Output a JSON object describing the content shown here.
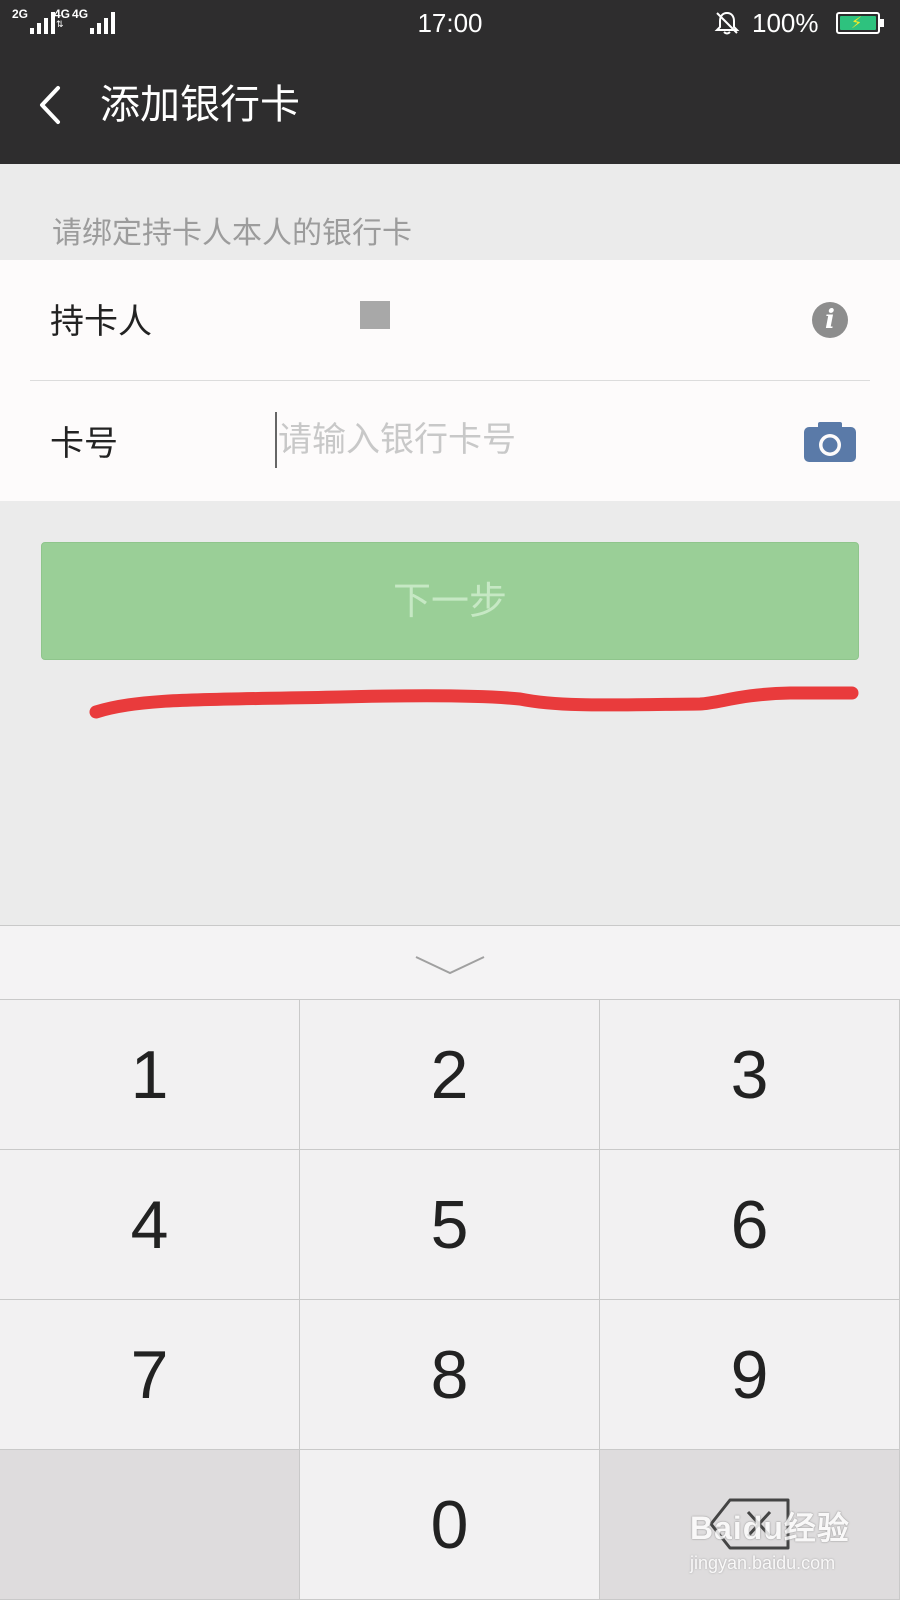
{
  "status_bar": {
    "sim1_label": "2G",
    "sim2_label": "4G",
    "sim2_label_b": "4G",
    "time": "17:00",
    "battery_percent": "100%",
    "battery_level": 1.0,
    "icons": [
      "signal-icon",
      "signal-icon",
      "silent-bell-icon",
      "battery-charging-icon"
    ]
  },
  "nav": {
    "back_icon": "chevron-left-icon",
    "title": "添加银行卡"
  },
  "form": {
    "hint": "请绑定持卡人本人的银行卡",
    "holder_label": "持卡人",
    "holder_value_masked": true,
    "holder_info_icon": "info-icon",
    "card_label": "卡号",
    "card_placeholder": "请输入银行卡号",
    "card_value": "",
    "camera_icon": "camera-icon"
  },
  "next_button": {
    "label": "下一步",
    "enabled": false
  },
  "colors": {
    "bar_bg": "#2e2d2e",
    "page_bg": "#ebebeb",
    "button_green": "#9acf97",
    "annotation_red": "#e93b3c",
    "camera_blue": "#5a7aa8"
  },
  "keyboard": {
    "collapse_icon": "chevron-down-icon",
    "keys": [
      "1",
      "2",
      "3",
      "4",
      "5",
      "6",
      "7",
      "8",
      "9",
      "",
      "0",
      ""
    ],
    "delete_icon": "backspace-icon"
  },
  "watermark": {
    "logo": "Baidu经验",
    "url": "jingyan.baidu.com"
  }
}
